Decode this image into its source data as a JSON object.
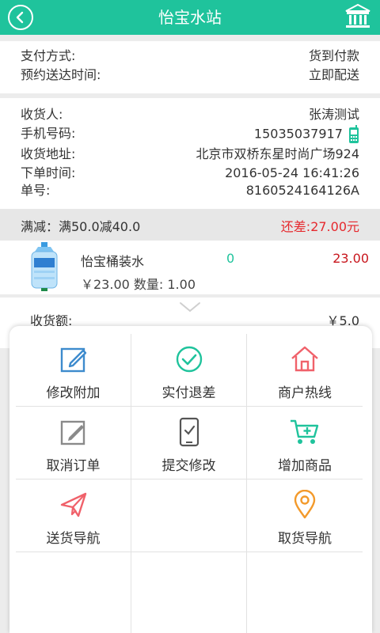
{
  "header": {
    "title": "怡宝水站"
  },
  "payment": {
    "method_label": "支付方式:",
    "method_value": "货到付款",
    "delivery_label": "预约送达时间:",
    "delivery_value": "立即配送"
  },
  "customer": {
    "name_label": "收货人:",
    "name_value": "张涛测试",
    "phone_label": "手机号码:",
    "phone_value": "15035037917",
    "address_label": "收货地址:",
    "address_value": "北京市双桥东星时尚广场924",
    "time_label": "下单时间:",
    "time_value": "2016-05-24 16:41:26",
    "order_label": "单号:",
    "order_value": "8160524164126A"
  },
  "discount": {
    "label": "满减：满50.0减40.0",
    "shortfall": "还差:27.00元"
  },
  "product": {
    "name": "怡宝桶装水",
    "quantity": "0",
    "price": "23.00",
    "detail": "￥23.00 数量: 1.00"
  },
  "collect": {
    "label": "收货额:",
    "value": "￥5.0"
  },
  "menu": [
    {
      "label": "修改附加",
      "icon": "edit-icon"
    },
    {
      "label": "实付退差",
      "icon": "check-circle-icon"
    },
    {
      "label": "商户热线",
      "icon": "house-icon"
    },
    {
      "label": "取消订单",
      "icon": "cancel-edit-icon"
    },
    {
      "label": "提交修改",
      "icon": "submit-phone-icon"
    },
    {
      "label": "增加商品",
      "icon": "cart-add-icon"
    },
    {
      "label": "送货导航",
      "icon": "paper-plane-icon"
    },
    {
      "label": "",
      "icon": ""
    },
    {
      "label": "取货导航",
      "icon": "location-pin-icon"
    }
  ],
  "colors": {
    "brand": "#1fc39c",
    "red": "#e6292e",
    "coral": "#f0616a",
    "blue": "#3d8bcd",
    "orange": "#f39a2b",
    "gray": "#8a8a8a"
  }
}
